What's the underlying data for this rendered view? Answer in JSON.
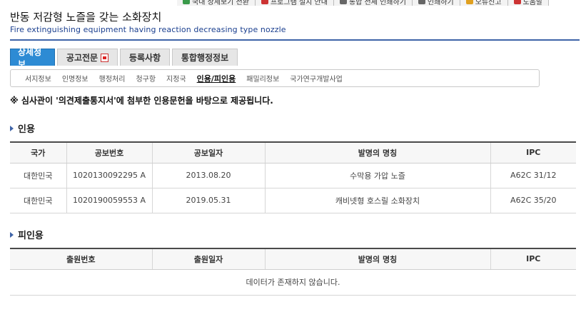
{
  "toolbar": {
    "items": [
      {
        "label": "국내 상세보기 전환",
        "icon": "globe-icon",
        "color": "#3a9a4a"
      },
      {
        "label": "프로그램 설치 안내",
        "icon": "wrench-icon",
        "color": "#cc3333"
      },
      {
        "label": "통합 전체 인쇄하기",
        "icon": "print-icon",
        "color": "#666666"
      },
      {
        "label": "인쇄하기",
        "icon": "print-icon",
        "color": "#666666"
      },
      {
        "label": "오류신고",
        "icon": "alert-icon",
        "color": "#e0a020"
      },
      {
        "label": "도움말",
        "icon": "help-icon",
        "color": "#cc3333"
      }
    ]
  },
  "header": {
    "title_ko": "반동 저감형 노즐을 갖는 소화장치",
    "title_en": "Fire extinguishing equipment having reaction decreasing type nozzle"
  },
  "tabs": [
    {
      "label": "상세정보",
      "active": true
    },
    {
      "label": "공고전문",
      "active": false,
      "icon": "pdf-icon"
    },
    {
      "label": "등록사항",
      "active": false
    },
    {
      "label": "통합행정정보",
      "active": false
    }
  ],
  "subnav": [
    {
      "label": "서지정보",
      "active": false
    },
    {
      "label": "인명정보",
      "active": false
    },
    {
      "label": "행정처리",
      "active": false
    },
    {
      "label": "청구항",
      "active": false
    },
    {
      "label": "지정국",
      "active": false
    },
    {
      "label": "인용/피인용",
      "active": true
    },
    {
      "label": "패밀리정보",
      "active": false
    },
    {
      "label": "국가연구개발사업",
      "active": false
    }
  ],
  "notice": "※ 심사관이 '의견제출통지서'에 첨부한 인용문헌을 바탕으로 제공됩니다.",
  "citations": {
    "heading": "인용",
    "columns": [
      "국가",
      "공보번호",
      "공보일자",
      "발명의 명칭",
      "IPC"
    ],
    "rows": [
      [
        "대한민국",
        "1020130092295 A",
        "2013.08.20",
        "수막용 가압 노즐",
        "A62C 31/12"
      ],
      [
        "대한민국",
        "1020190059553 A",
        "2019.05.31",
        "캐비넷형 호스릴 소화장치",
        "A62C 35/20"
      ]
    ]
  },
  "cited_by": {
    "heading": "피인용",
    "columns": [
      "출원번호",
      "출원일자",
      "발명의 명칭",
      "IPC"
    ],
    "empty_message": "데이터가 존재하지 않습니다."
  },
  "colors": {
    "accent": "#2d8bd4",
    "title_rule": "#3f64a8",
    "subtitle": "#1a3f8f"
  }
}
